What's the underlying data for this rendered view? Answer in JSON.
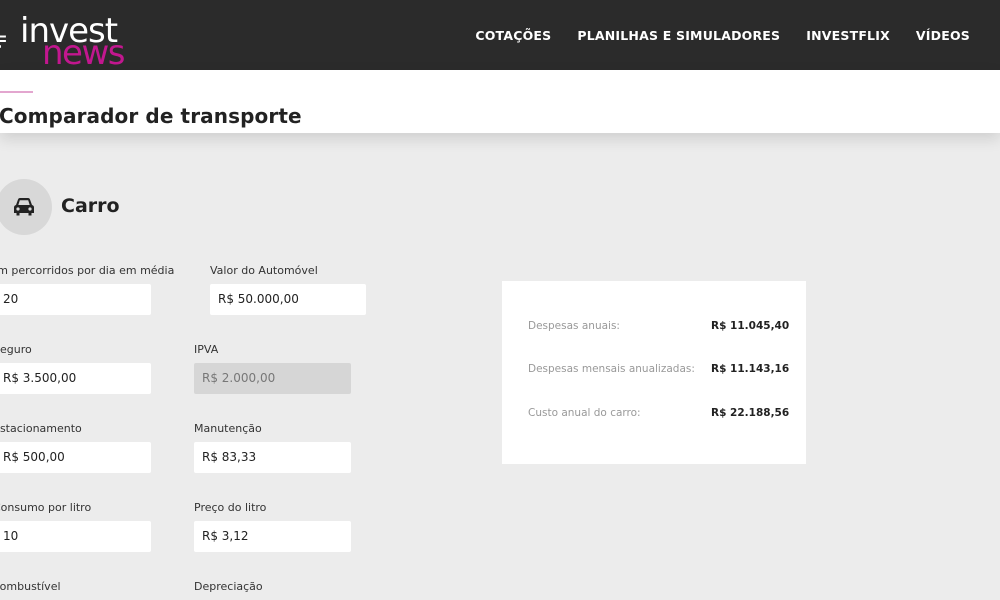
{
  "header": {
    "logo_top": "invest",
    "logo_bottom": "news",
    "nav": [
      "COTAÇÕES",
      "PLANILHAS E SIMULADORES",
      "INVESTFLIX",
      "VÍDEOS"
    ]
  },
  "page": {
    "title": "Comparador de transporte"
  },
  "section": {
    "title": "Carro",
    "icon": "car-icon"
  },
  "fields": {
    "km_dia": {
      "label": "Km percorridos por dia em média",
      "value": "20"
    },
    "valor_automovel": {
      "label": "Valor do Automóvel",
      "value": "R$ 50.000,00"
    },
    "seguro": {
      "label": "Seguro",
      "value": "R$ 3.500,00"
    },
    "ipva": {
      "label": "IPVA",
      "value": "R$ 2.000,00"
    },
    "estacionamento": {
      "label": "Estacionamento",
      "value": "R$ 500,00"
    },
    "manutencao": {
      "label": "Manutenção",
      "value": "R$ 83,33"
    },
    "consumo": {
      "label": "Consumo por litro",
      "value": "10"
    },
    "preco_litro": {
      "label": "Preço do litro",
      "value": "R$ 3,12"
    },
    "combustivel": {
      "label": "Combustível"
    },
    "depreciacao": {
      "label": "Depreciação"
    }
  },
  "results": [
    {
      "label": "Despesas anuais:",
      "value": "R$ 11.045,40"
    },
    {
      "label": "Despesas mensais anualizadas:",
      "value": "R$ 11.143,16"
    },
    {
      "label": "Custo anual do carro:",
      "value": "R$ 22.188,56"
    }
  ],
  "colors": {
    "brand": "#c2178f",
    "header_bg": "#2b2b2b",
    "page_bg": "#ececec"
  }
}
